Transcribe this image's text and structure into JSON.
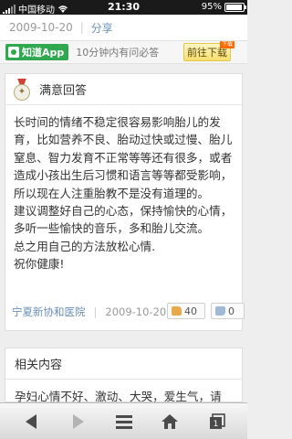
{
  "status_bar": {
    "carrier": "中国移动",
    "time": "21:30",
    "battery_text": "95%",
    "battery_level": 0.95
  },
  "meta": {
    "date": "2009-10-20",
    "separator": "|",
    "share": "分享"
  },
  "promo": {
    "app_label": "知道App",
    "text": "10分钟内有问必答",
    "button": "前往下载",
    "badge": "下载"
  },
  "answer": {
    "header": "满意回答",
    "paragraphs": [
      "长时间的情绪不稳定很容易影响胎儿的发育，比如营养不良、胎动过快或过慢、胎儿窒息、智力发育不正常等等还有很多，或者造成小孩出生后习惯和语言等等都受影响，所以现在人注重胎教不是没有道理的。",
      "建议调整好自己的心态，保持愉快的心情，多听一些愉快的音乐，多和胎儿交流。",
      "总之用自己的方法放松心情.",
      "祝你健康!"
    ],
    "author": "宁夏新协和医院",
    "separator": "|",
    "date": "2009-10-20",
    "likes": "40",
    "dislikes": "0"
  },
  "related": {
    "header": "相关内容",
    "first_item": "孕妇心情不好、激动、大哭，爱生气，请"
  },
  "toolbar": {
    "icons": [
      "back-icon",
      "forward-icon",
      "menu-icon",
      "home-icon",
      "tabs-icon"
    ],
    "tabs_count": "1"
  }
}
